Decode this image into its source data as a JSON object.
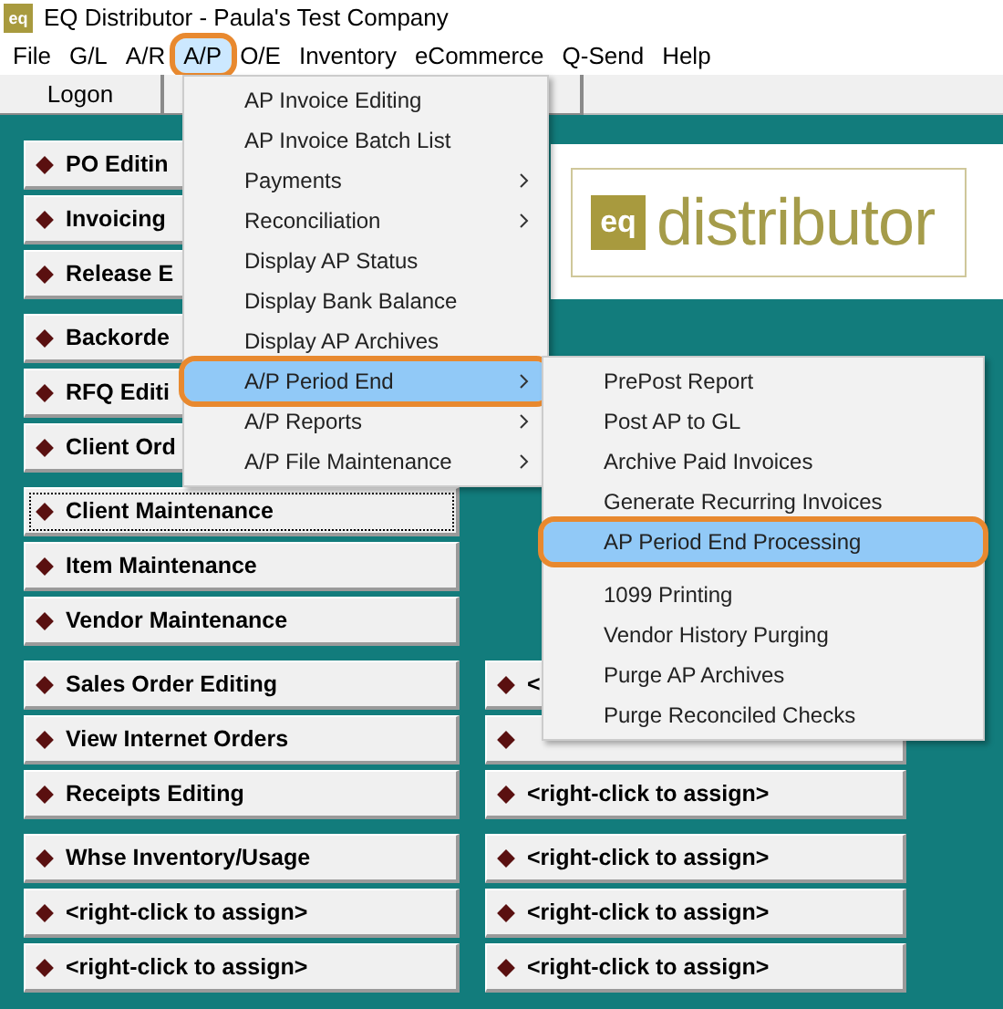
{
  "window": {
    "icon_text": "eq",
    "title": "EQ Distributor - Paula's Test Company"
  },
  "menu_bar": [
    {
      "label": "File",
      "selected": false,
      "circled": false
    },
    {
      "label": "G/L",
      "selected": false,
      "circled": false
    },
    {
      "label": "A/R",
      "selected": false,
      "circled": false
    },
    {
      "label": "A/P",
      "selected": true,
      "circled": true
    },
    {
      "label": "O/E",
      "selected": false,
      "circled": false
    },
    {
      "label": "Inventory",
      "selected": false,
      "circled": false
    },
    {
      "label": "eCommerce",
      "selected": false,
      "circled": false
    },
    {
      "label": "Q-Send",
      "selected": false,
      "circled": false
    },
    {
      "label": "Help",
      "selected": false,
      "circled": false
    }
  ],
  "toolbar": {
    "buttons": [
      "Logon"
    ]
  },
  "logo": {
    "mark": "eq",
    "text": "distributor"
  },
  "left_groups": [
    [
      {
        "label": "PO Editin",
        "focused": false
      },
      {
        "label": "Invoicing",
        "focused": false
      },
      {
        "label": "Release E",
        "focused": false
      }
    ],
    [
      {
        "label": "Backorde",
        "focused": false
      },
      {
        "label": "RFQ Editi",
        "focused": false
      },
      {
        "label": "Client Ord",
        "focused": false
      }
    ],
    [
      {
        "label": "Client Maintenance",
        "focused": true
      },
      {
        "label": "Item Maintenance",
        "focused": false
      },
      {
        "label": "Vendor Maintenance",
        "focused": false
      }
    ],
    [
      {
        "label": "Sales Order Editing",
        "focused": false
      },
      {
        "label": "View Internet Orders",
        "focused": false
      },
      {
        "label": "Receipts Editing",
        "focused": false
      }
    ],
    [
      {
        "label": "Whse Inventory/Usage",
        "focused": false
      },
      {
        "label": "<right-click to assign>",
        "focused": false
      },
      {
        "label": "<right-click to assign>",
        "focused": false
      }
    ]
  ],
  "right_groups": [
    [
      {
        "label": "<",
        "focused": false
      },
      {
        "focused": false
      },
      {
        "label": "<right-click to assign>",
        "focused": false
      }
    ],
    [
      {
        "label": "<right-click to assign>",
        "focused": false
      },
      {
        "label": "<right-click to assign>",
        "focused": false
      },
      {
        "label": "<right-click to assign>",
        "focused": false
      }
    ]
  ],
  "ap_menu": [
    {
      "label": "AP Invoice Editing",
      "submenu": false,
      "selected": false,
      "circled": false
    },
    {
      "label": "AP Invoice Batch List",
      "submenu": false,
      "selected": false,
      "circled": false
    },
    {
      "label": "Payments",
      "submenu": true,
      "selected": false,
      "circled": false
    },
    {
      "label": "Reconciliation",
      "submenu": true,
      "selected": false,
      "circled": false
    },
    {
      "label": "Display AP Status",
      "submenu": false,
      "selected": false,
      "circled": false
    },
    {
      "label": "Display Bank Balance",
      "submenu": false,
      "selected": false,
      "circled": false
    },
    {
      "label": "Display AP Archives",
      "submenu": false,
      "selected": false,
      "circled": false
    },
    {
      "label": "A/P Period End",
      "submenu": true,
      "selected": true,
      "circled": true
    },
    {
      "label": "A/P Reports",
      "submenu": true,
      "selected": false,
      "circled": false
    },
    {
      "label": "A/P File Maintenance",
      "submenu": true,
      "selected": false,
      "circled": false
    }
  ],
  "period_end_menu": [
    [
      {
        "label": "PrePost Report",
        "selected": false,
        "circled": false
      },
      {
        "label": "Post AP to GL",
        "selected": false,
        "circled": false
      },
      {
        "label": "Archive Paid Invoices",
        "selected": false,
        "circled": false
      },
      {
        "label": "Generate Recurring Invoices",
        "selected": false,
        "circled": false
      },
      {
        "label": "AP Period End Processing",
        "selected": true,
        "circled": true
      }
    ],
    [
      {
        "label": "1099 Printing",
        "selected": false,
        "circled": false
      },
      {
        "label": "Vendor History Purging",
        "selected": false,
        "circled": false
      },
      {
        "label": "Purge AP Archives",
        "selected": false,
        "circled": false
      },
      {
        "label": "Purge Reconciled Checks",
        "selected": false,
        "circled": false
      }
    ]
  ]
}
